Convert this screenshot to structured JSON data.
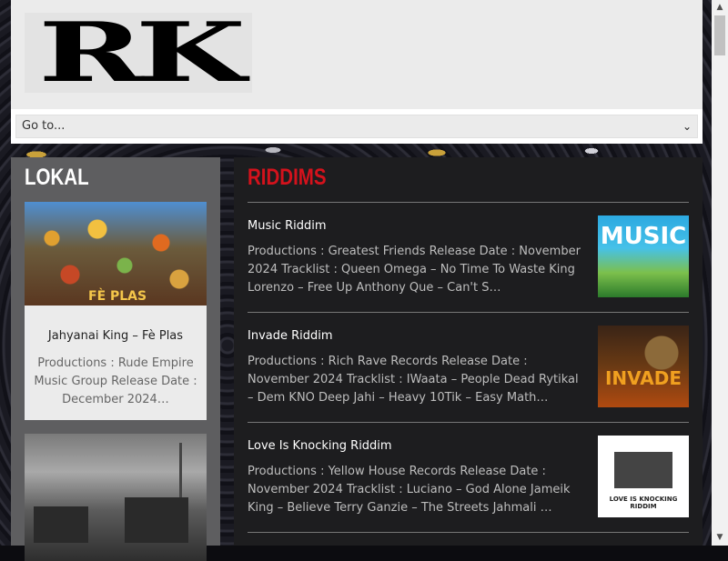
{
  "header": {
    "logo_text": "RK",
    "nav_select_value": "Go to...",
    "nav_icon": "chevron-down-icon"
  },
  "left": {
    "title": "LOKAL",
    "cards": [
      {
        "image_caption": "FÈ PLAS",
        "title": "Jahyanai King – Fè Plas",
        "excerpt": "Productions : Rude Empire Music Group Release Date : December 2024…"
      },
      {
        "image_caption": ""
      }
    ]
  },
  "main": {
    "title": "RIDDIMS",
    "posts": [
      {
        "title": "Music Riddim",
        "excerpt": "Productions : Greatest Friends Release Date : November 2024 Tracklist : Queen Omega – No Time To Waste King Lorenzo – Free Up Anthony Que – Can't S…",
        "thumb_text": "MUSIC"
      },
      {
        "title": "Invade Riddim",
        "excerpt": "Productions : Rich Rave Records Release Date : November 2024 Tracklist : IWaata – People Dead Rytikal – Dem KNO Deep Jahi – Heavy 10Tik – Easy Math…",
        "thumb_text": "INVADE"
      },
      {
        "title": "Love Is Knocking Riddim",
        "excerpt": "Productions : Yellow House Records Release Date : November 2024 Tracklist : Luciano – God Alone Jameik King – Believe Terry Ganzie – The Streets Jahmali …",
        "thumb_text": "LOVE IS KNOCKING RIDDIM"
      }
    ]
  },
  "colors": {
    "accent_red": "#d4121c",
    "panel_dark": "#1d1d1f",
    "panel_grey": "#5e5e60",
    "header_bg": "#ebebeb"
  }
}
